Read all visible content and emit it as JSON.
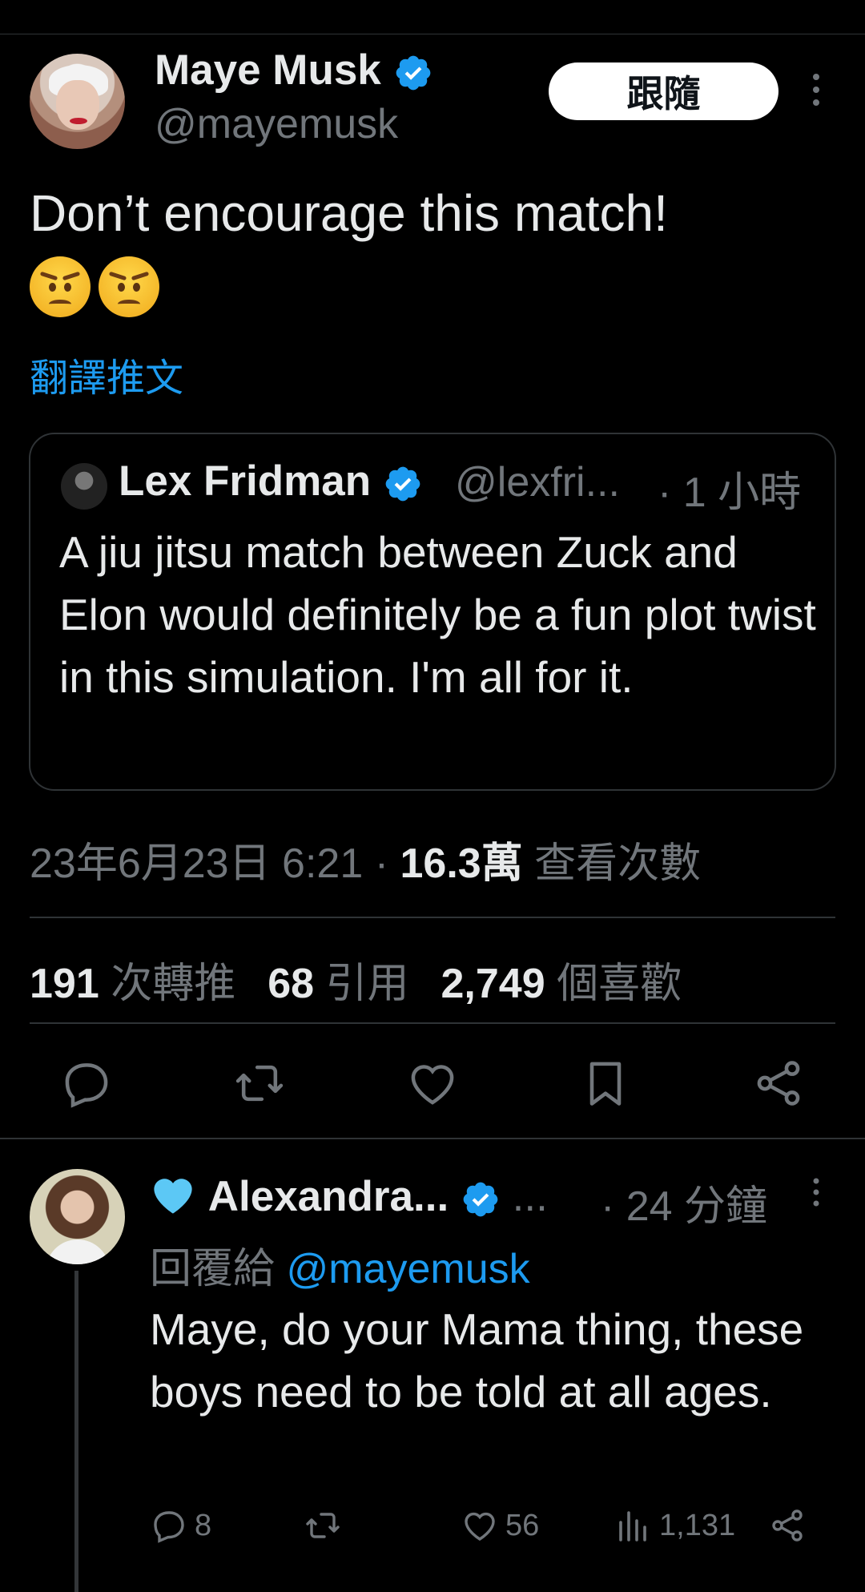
{
  "tweet": {
    "author_name": "Maye Musk",
    "author_handle": "@mayemusk",
    "follow_label": "跟隨",
    "text": "Don’t encourage this match!",
    "emoji_count": 2,
    "translate_label": "翻譯推文",
    "date_time": "23年6月23日 6:21",
    "separator": " · ",
    "views_count": "16.3萬",
    "views_label": " 查看次數",
    "retweets_count": "191",
    "retweets_label": " 次轉推",
    "quotes_count": "68",
    "quotes_label": " 引用",
    "likes_count": "2,749",
    "likes_label": " 個喜歡"
  },
  "quote": {
    "author_name": "Lex Fridman",
    "author_handle": "@lexfri...",
    "time": "· 1 小時",
    "text": "A jiu jitsu match between Zuck and Elon would definitely be a fun plot twist in this simulation. I'm all for it."
  },
  "reply": {
    "author_name": "Alexandra...",
    "dots": " ...",
    "time": "· 24 分鐘",
    "replying_label": "回覆給 ",
    "replying_mention": "@mayemusk",
    "text": "Maye, do your Mama thing, these boys need to be told at all ages.",
    "reply_count": "8",
    "like_count": "56",
    "views_count": "1,131"
  },
  "colors": {
    "background": "#000000",
    "text_primary": "#e7e9ea",
    "text_secondary": "#71767b",
    "accent": "#1d9bf0",
    "divider": "#2f3336"
  },
  "icons": {
    "verified": "verified-badge-icon",
    "more": "more-dots-icon",
    "reply": "reply-bubble-icon",
    "retweet": "retweet-icon",
    "like": "heart-icon",
    "bookmark": "bookmark-icon",
    "share": "share-icon",
    "views": "views-bar-icon",
    "blue_heart": "blue-heart-emoji"
  }
}
